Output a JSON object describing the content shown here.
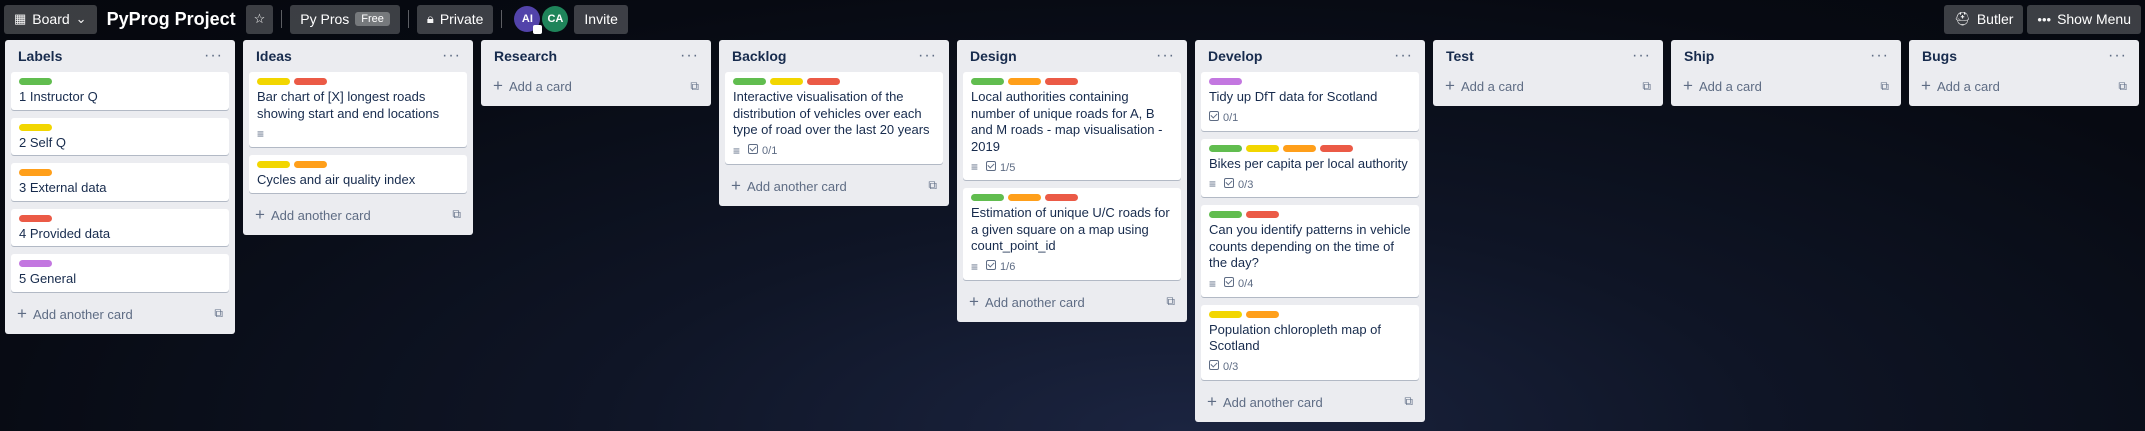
{
  "colors": {
    "green": "#61bd4f",
    "yellow": "#f2d600",
    "orange": "#ff9f1a",
    "red": "#eb5a46",
    "purple": "#c377e0"
  },
  "header": {
    "board_switch_label": "Board",
    "board_title": "PyProg Project",
    "team_label": "Py Pros",
    "team_badge": "Free",
    "visibility_label": "Private",
    "avatars": [
      "AI",
      "CA"
    ],
    "invite_label": "Invite",
    "butler_label": "Butler",
    "show_menu_label": "Show Menu"
  },
  "lists": [
    {
      "title": "Labels",
      "add_label": "Add another card",
      "cards": [
        {
          "labels": [
            "green"
          ],
          "title": "1 Instructor Q"
        },
        {
          "labels": [
            "yellow"
          ],
          "title": "2 Self Q"
        },
        {
          "labels": [
            "orange"
          ],
          "title": "3 External data"
        },
        {
          "labels": [
            "red"
          ],
          "title": "4 Provided data"
        },
        {
          "labels": [
            "purple"
          ],
          "title": "5 General"
        }
      ]
    },
    {
      "title": "Ideas",
      "add_label": "Add another card",
      "cards": [
        {
          "labels": [
            "yellow",
            "red"
          ],
          "title": "Bar chart of [X] longest roads showing start and end locations",
          "description": true
        },
        {
          "labels": [
            "yellow",
            "orange"
          ],
          "title": "Cycles and air quality index"
        }
      ]
    },
    {
      "title": "Research",
      "add_label": "Add a card",
      "cards": []
    },
    {
      "title": "Backlog",
      "add_label": "Add another card",
      "cards": [
        {
          "labels": [
            "green",
            "yellow",
            "red"
          ],
          "title": "Interactive visualisation of the distribution of vehicles over each type of road over the last 20 years",
          "description": true,
          "checklist": "0/1"
        }
      ]
    },
    {
      "title": "Design",
      "add_label": "Add another card",
      "cards": [
        {
          "labels": [
            "green",
            "orange",
            "red"
          ],
          "title": "Local authorities containing number of unique roads for A, B and M roads - map visualisation - 2019",
          "description": true,
          "checklist": "1/5"
        },
        {
          "labels": [
            "green",
            "orange",
            "red"
          ],
          "title": "Estimation of unique U/C roads for a given square on a map using count_point_id",
          "description": true,
          "checklist": "1/6"
        }
      ]
    },
    {
      "title": "Develop",
      "add_label": "Add another card",
      "cards": [
        {
          "labels": [
            "purple"
          ],
          "title": "Tidy up DfT data for Scotland",
          "checklist": "0/1"
        },
        {
          "labels": [
            "green",
            "yellow",
            "orange",
            "red"
          ],
          "title": "Bikes per capita per local authority",
          "description": true,
          "checklist": "0/3"
        },
        {
          "labels": [
            "green",
            "red"
          ],
          "title": "Can you identify patterns in vehicle counts depending on the time of the day?",
          "description": true,
          "checklist": "0/4"
        },
        {
          "labels": [
            "yellow",
            "orange"
          ],
          "title": "Population chloropleth map of Scotland",
          "checklist": "0/3"
        }
      ]
    },
    {
      "title": "Test",
      "add_label": "Add a card",
      "cards": []
    },
    {
      "title": "Ship",
      "add_label": "Add a card",
      "cards": []
    },
    {
      "title": "Bugs",
      "add_label": "Add a card",
      "cards": []
    }
  ]
}
